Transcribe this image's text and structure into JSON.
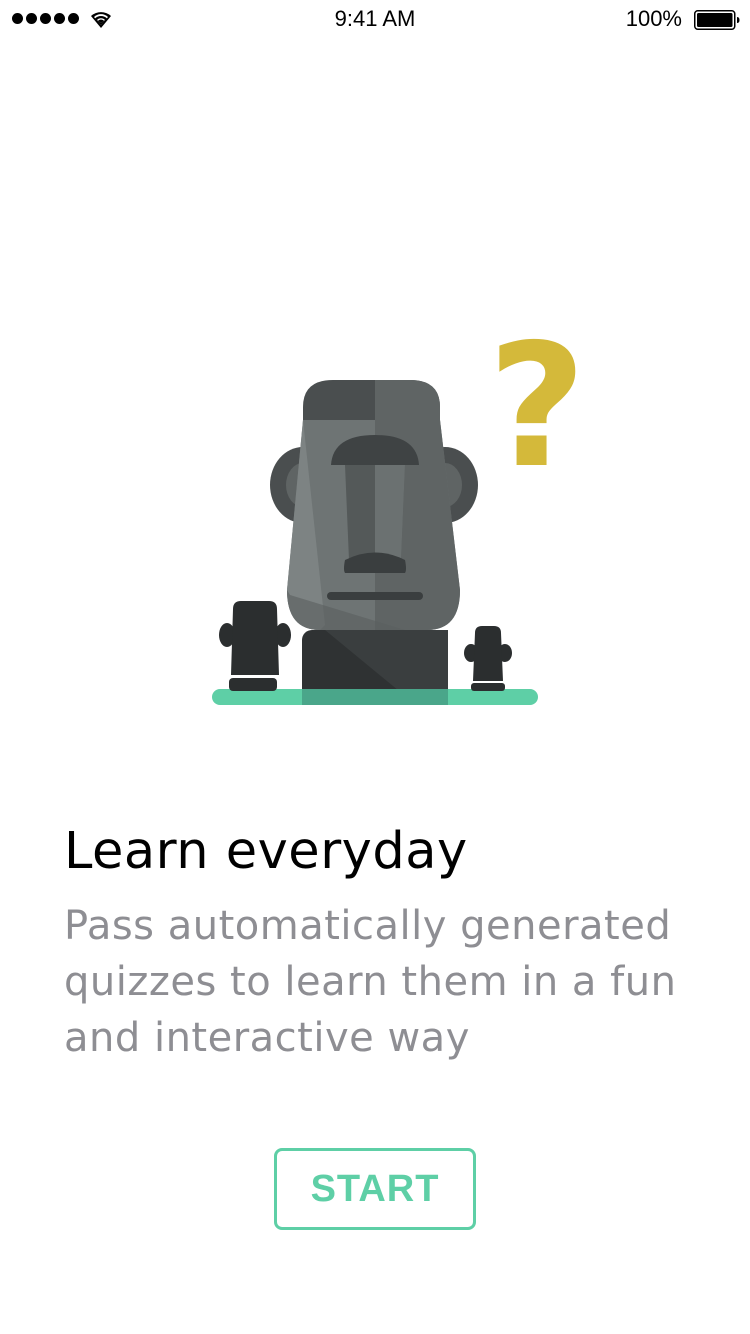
{
  "status_bar": {
    "time": "9:41 AM",
    "battery_percent": "100%",
    "signal_bars": 5,
    "icons": [
      "signal-dots-icon",
      "wifi-icon",
      "battery-icon"
    ]
  },
  "illustration": {
    "subject": "moai-statue-illustration",
    "question_mark": "?"
  },
  "onboarding": {
    "title": "Learn everyday",
    "description_lines": [
      "Pass automatically generated",
      "quizzes to learn them in a fun",
      "and interactive way"
    ]
  },
  "actions": {
    "start_label": "START"
  },
  "colors": {
    "accent": "#5ecfa6",
    "question_mark": "#d4b93a",
    "stone_dark": "#2b2e2f",
    "stone_mid": "#5f6464",
    "stone_light": "#7d8383",
    "description_text": "#8e8e93"
  }
}
